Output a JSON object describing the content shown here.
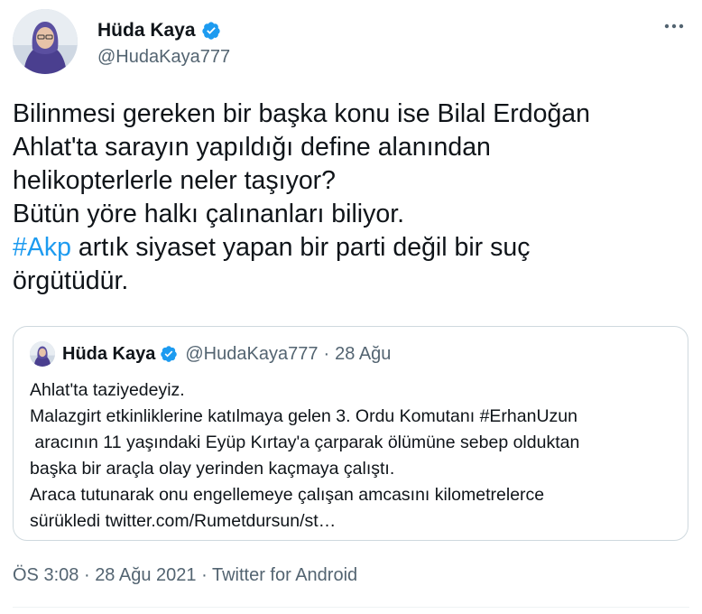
{
  "author": {
    "display_name": "Hüda Kaya",
    "handle": "@HudaKaya777"
  },
  "tweet": {
    "text_1": "Bilinmesi gereken bir başka konu ise Bilal Erdoğan\nAhlat'ta sarayın yapıldığı define alanından\nhelikopterlerle neler taşıyor?\nBütün yöre halkı çalınanları biliyor.\n",
    "hashtag": "#Akp",
    "text_2": " artık siyaset yapan bir parti değil bir suç\nörgütüdür."
  },
  "quoted": {
    "display_name": "Hüda Kaya",
    "handle": "@HudaKaya777",
    "separator": "·",
    "date": "28 Ağu",
    "text": "Ahlat'ta taziyedeyiz.\nMalazgirt etkinliklerine katılmaya gelen 3. Ordu Komutanı #ErhanUzun\n aracının 11 yaşındaki Eyüp Kırtay'a çarparak ölümüne sebep olduktan\nbaşka bir araçla olay yerinden kaçmaya çalıştı.\nAraca tutunarak onu engellemeye çalışan amcasını kilometrelerce\nsürükledi twitter.com/Rumetdursun/st…"
  },
  "meta": {
    "time": "ÖS 3:08",
    "date": "28 Ağu 2021",
    "separator": "·",
    "source": "Twitter for Android"
  },
  "icons": {
    "verified": "verified-badge-icon",
    "more": "more-options-icon"
  },
  "colors": {
    "link": "#1d9bf0",
    "secondary_text": "#536471",
    "border": "#cfd9de",
    "verified": "#1d9bf0"
  }
}
